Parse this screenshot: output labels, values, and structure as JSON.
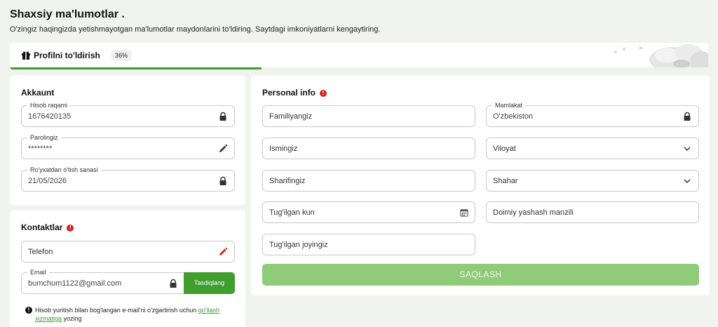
{
  "header": {
    "title": "Shaxsiy ma'lumotlar .",
    "subtitle": "O'zingiz haqingizda yetishmayotgan ma'lumotlar maydonlarini to'ldiring. Saytdagi imkoniyatlarni kengaytiring."
  },
  "progress": {
    "label": "Profilni to'ldirish",
    "percent_text": "36%",
    "fraction": 0.36,
    "fill_color": "#3f9e2d"
  },
  "account": {
    "title": "Akkaunt",
    "fields": [
      {
        "label": "Hisob raqami",
        "value": "1676420135",
        "icon": "lock-icon"
      },
      {
        "label": "Parolingiz",
        "value": "********",
        "icon": "pencil-icon"
      },
      {
        "label": "Ro'yxatdan o'tish sanasi",
        "value": "21/05/2026",
        "icon": "lock-icon"
      }
    ]
  },
  "contacts": {
    "title": "Kontaktlar",
    "phone_placeholder": "Telefon",
    "email_label": "Email",
    "email_value": "bumchum1122@gmail.com",
    "confirm_label": "Tasdiqlang",
    "note_text": "Hisob yuritish bilan bog'langan e-mail'ni o'zgartirish uchun ",
    "note_link": "qo'llash xizmatiga",
    "note_suffix": " yozing"
  },
  "personal": {
    "title": "Personal info",
    "surname": "Familiyangiz",
    "name": "Ismingiz",
    "patronymic": "Sharifingiz",
    "birth_date": "Tug'ilgan kun",
    "birth_place": "Tug'ilgan joyingiz",
    "country_label": "Mamlakat",
    "country_value": "O'zbekiston",
    "region": "Viloyat",
    "city": "Shahar",
    "address": "Doimiy yashash manzili",
    "save_label": "SAQLASH"
  },
  "colors": {
    "accent": "#3f9e2d",
    "alert": "#d32222",
    "background": "#f1f4ee"
  }
}
